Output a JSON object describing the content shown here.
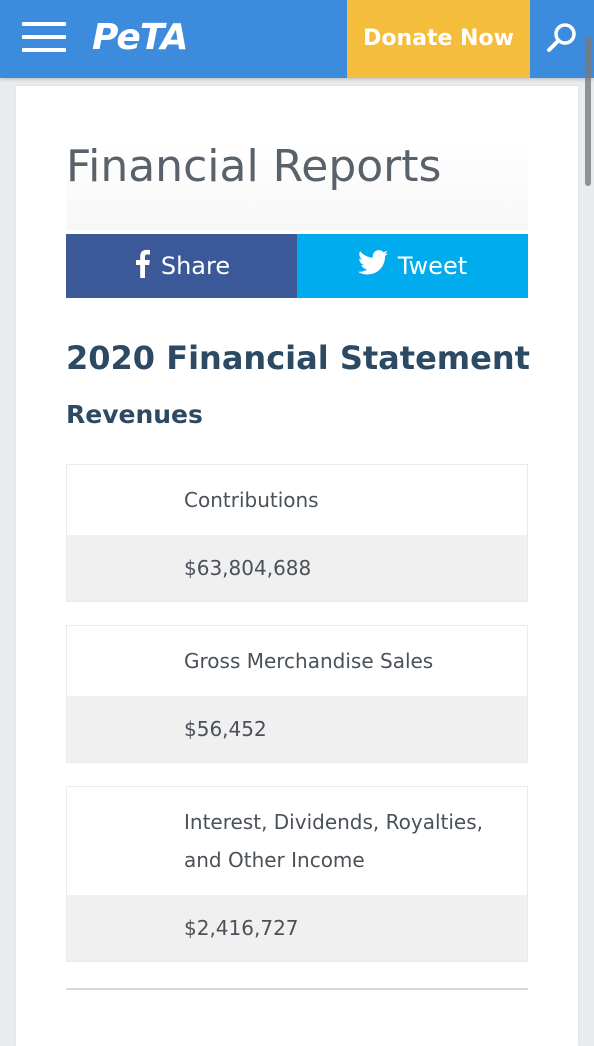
{
  "header": {
    "logo": "PeTA",
    "donate_label": "Donate Now",
    "menu_icon": "hamburger-menu-icon",
    "search_icon": "search-icon",
    "colors": {
      "bar": "#3d8bdd",
      "donate": "#f5bd3c"
    }
  },
  "page": {
    "title": "Financial Reports"
  },
  "share": {
    "share_label": "Share",
    "tweet_label": "Tweet",
    "colors": {
      "facebook": "#3b5998",
      "twitter": "#00aced"
    }
  },
  "statement": {
    "title": "2020 Financial Statement",
    "revenues_title": "Revenues",
    "revenues": [
      {
        "label": "Contributions",
        "value": "$63,804,688"
      },
      {
        "label": "Gross Merchandise Sales",
        "value": "$56,452"
      },
      {
        "label": "Interest, Dividends, Royalties, and Other Income",
        "value": "$2,416,727"
      }
    ]
  }
}
